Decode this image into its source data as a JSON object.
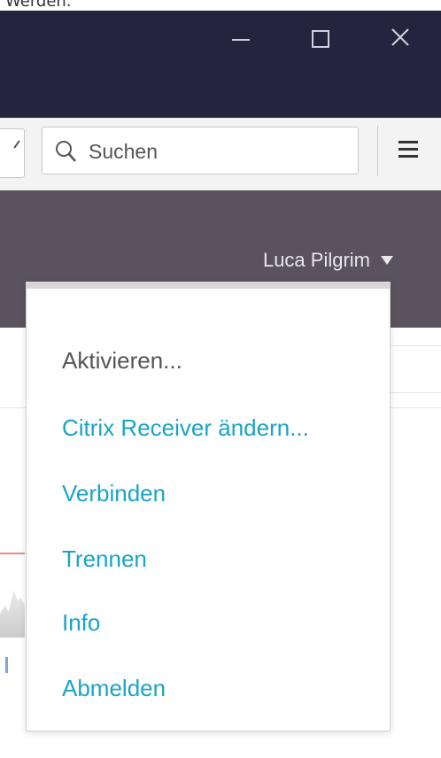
{
  "caption_fragment": "Werden.",
  "window": {
    "minimize_icon": "minimize-icon",
    "maximize_icon": "maximize-icon",
    "close_icon": "close-icon"
  },
  "toolbar": {
    "search_placeholder": "Suchen",
    "menu_icon": "hamburger-menu-icon"
  },
  "header": {
    "user_name": "Luca Pilgrim",
    "caret_icon": "caret-down-icon"
  },
  "dropdown": {
    "items": [
      {
        "label": "Aktivieren...",
        "enabled": false
      },
      {
        "label": "Citrix Receiver ändern...",
        "enabled": true
      },
      {
        "label": "Verbinden",
        "enabled": true
      },
      {
        "label": "Trennen",
        "enabled": true
      },
      {
        "label": "Info",
        "enabled": true
      },
      {
        "label": "Abmelden",
        "enabled": true
      }
    ]
  },
  "colors": {
    "titlebar": "#24243f",
    "header": "#5b5260",
    "link": "#1aa3c8",
    "disabled": "#555555"
  }
}
